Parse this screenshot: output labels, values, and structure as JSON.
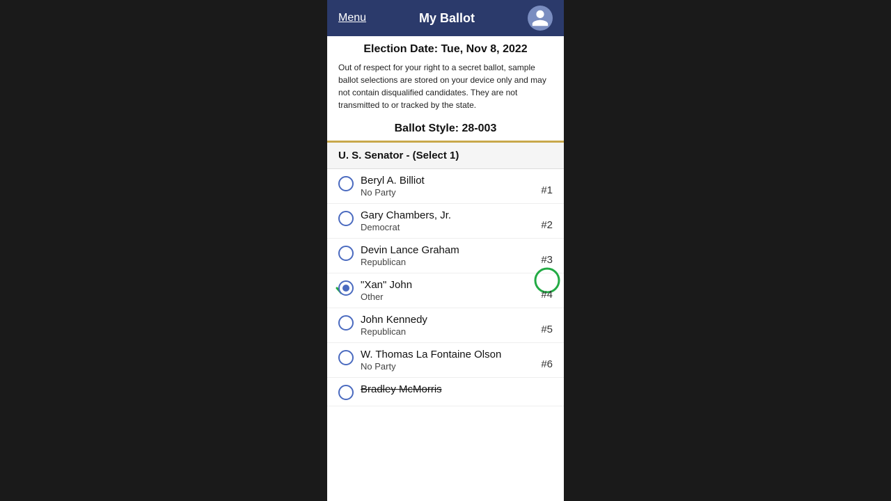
{
  "header": {
    "menu_label": "Menu",
    "title": "My Ballot"
  },
  "election_date": "Election Date: Tue, Nov 8, 2022",
  "privacy_notice": "Out of respect for your right to a secret ballot, sample ballot selections are stored on your device only and may not contain disqualified candidates. They are not transmitted to or tracked by the state.",
  "ballot_style": "Ballot Style: 28-003",
  "race": {
    "title": "U. S. Senator -  (Select 1)"
  },
  "candidates": [
    {
      "name": "Beryl A. Billiot",
      "party": "No Party",
      "number": "#1",
      "selected": false,
      "annotated": false,
      "strikethrough": false
    },
    {
      "name": "Gary Chambers, Jr.",
      "party": "Democrat",
      "number": "#2",
      "selected": false,
      "annotated": false,
      "strikethrough": false
    },
    {
      "name": "Devin Lance Graham",
      "party": "Republican",
      "number": "#3",
      "selected": false,
      "annotated": false,
      "strikethrough": false
    },
    {
      "name": "\"Xan\" John",
      "party": "Other",
      "number": "#4",
      "selected": true,
      "annotated": true,
      "strikethrough": false
    },
    {
      "name": "John Kennedy",
      "party": "Republican",
      "number": "#5",
      "selected": false,
      "annotated": false,
      "strikethrough": false
    },
    {
      "name": "W. Thomas La Fontaine Olson",
      "party": "No Party",
      "number": "#6",
      "selected": false,
      "annotated": false,
      "strikethrough": false
    },
    {
      "name": "Bradley McMorris",
      "party": "",
      "number": "",
      "selected": false,
      "annotated": false,
      "strikethrough": true
    }
  ]
}
